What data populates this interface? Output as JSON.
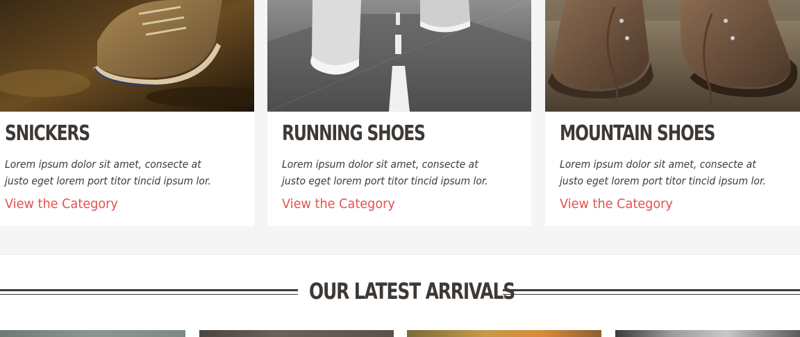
{
  "categories": [
    {
      "title": "SNICKERS",
      "description": "Lorem ipsum dolor sit amet, consecte at justo eget lorem port titor tincid ipsum lor.",
      "link_label": "View the Category",
      "image": "sneaker-in-puddle-photo"
    },
    {
      "title": "RUNNING SHOES",
      "description": "Lorem ipsum dolor sit amet, consecte at justo eget lorem port titor tincid ipsum lor.",
      "link_label": "View the Category",
      "image": "running-shoes-on-road-photo"
    },
    {
      "title": "MOUNTAIN SHOES",
      "description": "Lorem ipsum dolor sit amet, consecte at justo eget lorem port titor tincid ipsum lor.",
      "link_label": "View the Category",
      "image": "hiking-boots-on-rock-photo"
    }
  ],
  "arrivals": {
    "title": "OUR LATEST ARRIVALS",
    "products": [
      {
        "image": "arrival-product-photo-1"
      },
      {
        "image": "arrival-product-photo-2"
      },
      {
        "image": "arrival-product-photo-3"
      },
      {
        "image": "arrival-product-photo-4"
      }
    ]
  },
  "colors": {
    "heading": "#3e3935",
    "link_accent": "#e0534f",
    "page_background": "#f5f5f5",
    "card_background": "#ffffff"
  }
}
